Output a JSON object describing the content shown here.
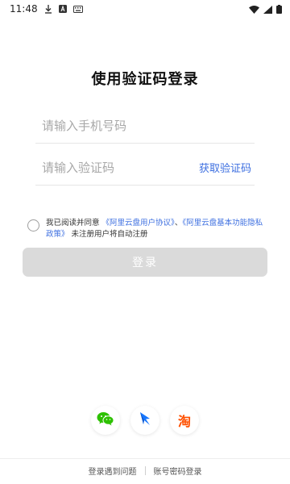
{
  "status_bar": {
    "time": "11:48",
    "icons": [
      "download-icon",
      "notification-a-icon",
      "keyboard-icon",
      "wifi-icon",
      "signal-icon",
      "battery-icon"
    ]
  },
  "page": {
    "title": "使用验证码登录"
  },
  "form": {
    "phone_placeholder": "请输入手机号码",
    "code_placeholder": "请输入验证码",
    "get_code_label": "获取验证码"
  },
  "agreement": {
    "prefix": "我已阅读并同意",
    "link_user_agreement": "《阿里云盘用户协议》",
    "separator": "、",
    "link_privacy_policy": "《阿里云盘基本功能隐私政策》",
    "suffix": "未注册用户将自动注册"
  },
  "login_button": {
    "label": "登录"
  },
  "third_party": {
    "options": [
      "wechat-icon",
      "alipay-icon",
      "taobao-icon"
    ],
    "taobao_glyph": "淘"
  },
  "bottom_links": {
    "problem": "登录遇到问题",
    "password_login": "账号密码登录"
  },
  "colors": {
    "accent": "#3d6fe0",
    "button_disabled": "#dadada",
    "wechat": "#2dc100",
    "alipay": "#1677ff",
    "taobao": "#ff5000"
  }
}
